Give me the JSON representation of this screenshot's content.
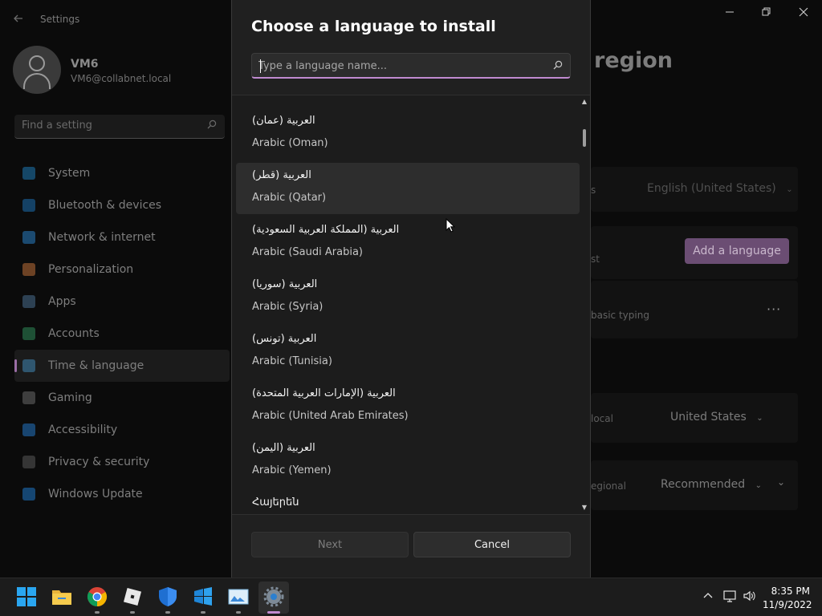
{
  "settings": {
    "app_title": "Settings",
    "user": {
      "name": "VM6",
      "email": "VM6@collabnet.local"
    },
    "search_placeholder": "Find a setting",
    "nav": [
      {
        "label": "System",
        "icon": "monitor-icon",
        "color": "#1f7ab5",
        "active": false
      },
      {
        "label": "Bluetooth & devices",
        "icon": "bluetooth-icon",
        "color": "#1d6fb0",
        "active": false
      },
      {
        "label": "Network & internet",
        "icon": "wifi-icon",
        "color": "#2a7fc4",
        "active": false
      },
      {
        "label": "Personalization",
        "icon": "brush-icon",
        "color": "#c0713a",
        "active": false
      },
      {
        "label": "Apps",
        "icon": "apps-icon",
        "color": "#4a6f8f",
        "active": false
      },
      {
        "label": "Accounts",
        "icon": "person-icon",
        "color": "#2f8a5a",
        "active": false
      },
      {
        "label": "Time & language",
        "icon": "globe-clock-icon",
        "color": "#3f86b5",
        "active": true
      },
      {
        "label": "Gaming",
        "icon": "gamepad-icon",
        "color": "#6a6a6a",
        "active": false
      },
      {
        "label": "Accessibility",
        "icon": "accessibility-icon",
        "color": "#2477c4",
        "active": false
      },
      {
        "label": "Privacy & security",
        "icon": "shield-icon",
        "color": "#5a5a5a",
        "active": false
      },
      {
        "label": "Windows Update",
        "icon": "update-icon",
        "color": "#1f78c8",
        "active": false
      }
    ],
    "page_title_fragment": "region",
    "bg_rows": {
      "display_language_fragment": "s",
      "display_language_value": "English (United States)",
      "preferred_fragment": "st",
      "add_language_label": "Add a language",
      "typing_fragment": "basic typing",
      "more_label": "···",
      "country_fragment": "local",
      "country_value": "United States",
      "format_fragment": "egional",
      "format_value": "Recommended"
    }
  },
  "dialog": {
    "title": "Choose a language to install",
    "search_placeholder": "Type a language name...",
    "languages": [
      {
        "native": "العربية (عمان)",
        "english": "Arabic (Oman)",
        "hover": false
      },
      {
        "native": "العربية (قطر)",
        "english": "Arabic (Qatar)",
        "hover": true
      },
      {
        "native": "العربية (المملكة العربية السعودية)",
        "english": "Arabic (Saudi Arabia)",
        "hover": false
      },
      {
        "native": "العربية (سوريا)",
        "english": "Arabic (Syria)",
        "hover": false
      },
      {
        "native": "العربية (تونس)",
        "english": "Arabic (Tunisia)",
        "hover": false
      },
      {
        "native": "العربية (الإمارات العربية المتحدة)",
        "english": "Arabic (United Arab Emirates)",
        "hover": false
      },
      {
        "native": "العربية (اليمن)",
        "english": "Arabic (Yemen)",
        "hover": false
      },
      {
        "native": "Հայերեն",
        "english": "",
        "hover": false
      }
    ],
    "next_label": "Next",
    "cancel_label": "Cancel"
  },
  "taskbar": {
    "apps": [
      "start-icon",
      "file-explorer-icon",
      "chrome-icon",
      "roblox-icon",
      "defender-icon",
      "app-icon",
      "photos-icon",
      "settings-gear-icon"
    ],
    "time": "8:35 PM",
    "date": "11/9/2022"
  },
  "colors": {
    "accent": "#c08ad0",
    "dialog_bg": "#202020",
    "list_bg": "#1c1c1c",
    "hover_bg": "#2d2d2d"
  }
}
